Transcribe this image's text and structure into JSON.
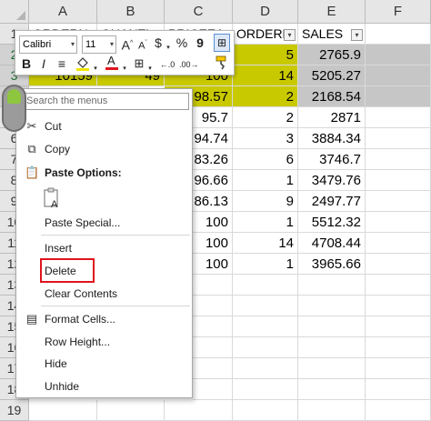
{
  "columns": [
    "A",
    "B",
    "C",
    "D",
    "E",
    "F"
  ],
  "rows": [
    "1",
    "2",
    "3",
    "4",
    "5",
    "6",
    "7",
    "8",
    "9",
    "10",
    "11",
    "12",
    "13",
    "14",
    "15",
    "16",
    "17",
    "18",
    "19"
  ],
  "headers": [
    "ORDERN",
    "QUANTI",
    "PRICEEA",
    "ORDERLI",
    "SALES"
  ],
  "visible_cells": {
    "b3": "10159",
    "b3_partial": "49",
    "c3": "100",
    "c4": "98.57",
    "c5": "95.7",
    "c6": "94.74",
    "c7": "83.26",
    "c8": "96.66",
    "c9": "86.13",
    "c10": "100",
    "c11": "100",
    "c12": "100",
    "d2": "5",
    "d3": "14",
    "d4": "2",
    "d5": "2",
    "d6": "3",
    "d7": "6",
    "d8": "1",
    "d9": "9",
    "d10": "1",
    "d11": "14",
    "d12": "1",
    "e2": "2765.9",
    "e3": "5205.27",
    "e4": "2168.54",
    "e5": "2871",
    "e6": "3884.34",
    "e7": "3746.7",
    "e8": "3479.76",
    "e9": "2497.77",
    "e10": "5512.32",
    "e11": "4708.44",
    "e12": "3965.66"
  },
  "mini_toolbar": {
    "font_name": "Calibri",
    "font_size": "11",
    "bold": "B",
    "italic": "I",
    "currency": "$",
    "percent": "%",
    "comma": "9"
  },
  "menu": {
    "search_placeholder": "Search the menus",
    "cut": "Cut",
    "copy": "Copy",
    "paste_options": "Paste Options:",
    "paste_special": "Paste Special...",
    "insert": "Insert",
    "delete": "Delete",
    "clear_contents": "Clear Contents",
    "format_cells": "Format Cells...",
    "row_height": "Row Height...",
    "hide": "Hide",
    "unhide": "Unhide"
  },
  "colors": {
    "highlight_yellow": "#c9c900",
    "selection_gray": "#c6c6c6",
    "annotation_red": "#e0141e",
    "excel_green": "#217346"
  }
}
